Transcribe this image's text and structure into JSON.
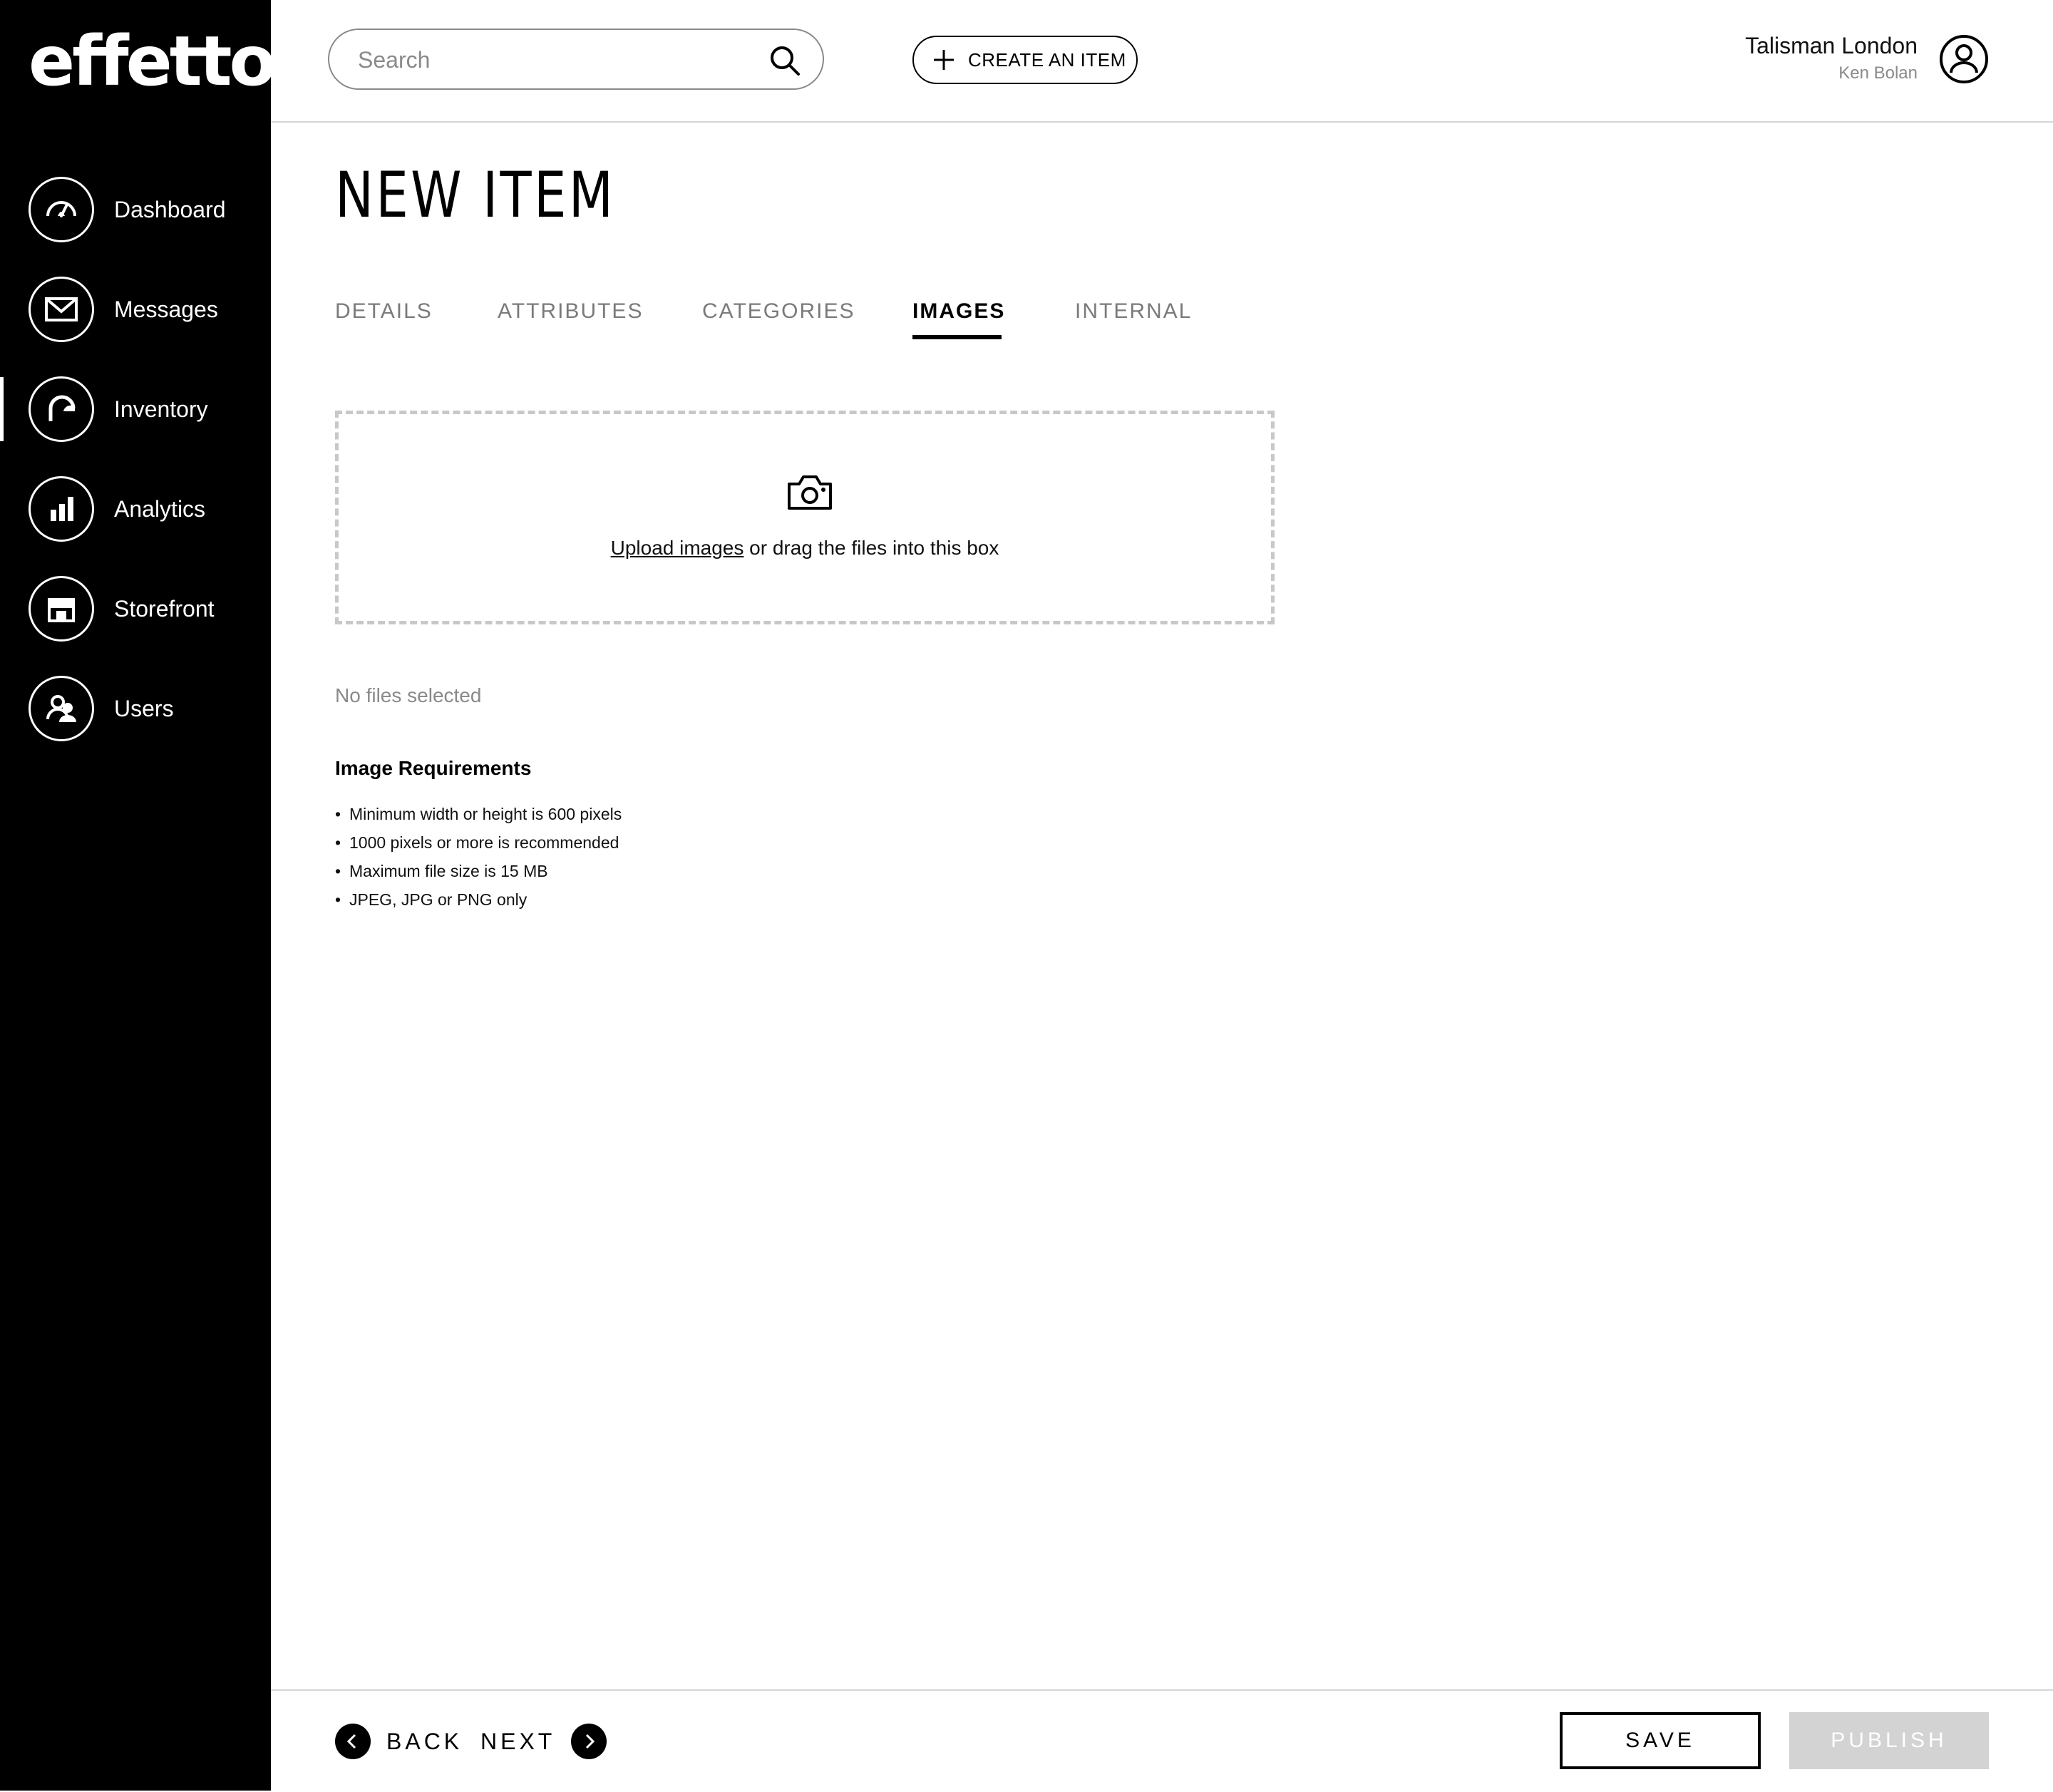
{
  "app": {
    "logo": "effetto"
  },
  "sidebar": {
    "items": [
      {
        "label": "Dashboard",
        "icon": "dashboard-gauge-icon",
        "active": false
      },
      {
        "label": "Messages",
        "icon": "envelope-icon",
        "active": false
      },
      {
        "label": "Inventory",
        "icon": "inventory-icon",
        "active": true
      },
      {
        "label": "Analytics",
        "icon": "bar-chart-icon",
        "active": false
      },
      {
        "label": "Storefront",
        "icon": "storefront-icon",
        "active": false
      },
      {
        "label": "Users",
        "icon": "users-icon",
        "active": false
      }
    ]
  },
  "header": {
    "search_placeholder": "Search",
    "create_label": "CREATE AN ITEM",
    "user_name": "Talisman London",
    "user_sub": "Ken Bolan"
  },
  "page": {
    "title": "NEW ITEM",
    "tabs": [
      {
        "label": "DETAILS",
        "active": false
      },
      {
        "label": "ATTRIBUTES",
        "active": false
      },
      {
        "label": "CATEGORIES",
        "active": false
      },
      {
        "label": "IMAGES",
        "active": true
      },
      {
        "label": "INTERNAL",
        "active": false
      }
    ]
  },
  "upload": {
    "link_text": "Upload images",
    "rest_text": " or drag the files into this box",
    "status": "No files selected"
  },
  "requirements": {
    "title": "Image Requirements",
    "items": [
      "Minimum width or height is 600 pixels",
      "1000 pixels or more is recommended",
      "Maximum file size is 15 MB",
      "JPEG, JPG or PNG only"
    ]
  },
  "footer": {
    "back_label": "BACK",
    "next_label": "NEXT",
    "save_label": "SAVE",
    "publish_label": "PUBLISH"
  },
  "colors": {
    "sidebar_bg": "#000000",
    "publish_disabled_bg": "#d3d3d3",
    "muted_text": "#8a8a8a",
    "dashed_border": "#c8c8c8"
  }
}
